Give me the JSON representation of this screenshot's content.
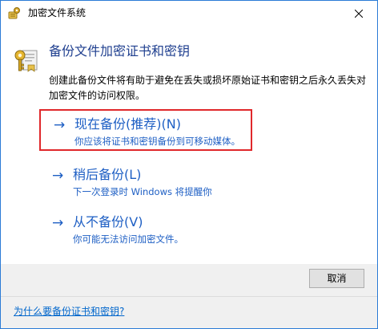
{
  "window": {
    "title": "加密文件系统",
    "close_label": "×"
  },
  "main": {
    "heading": "备份文件加密证书和密钥",
    "description": "创建此备份文件将有助于避免在丢失或损坏原始证书和密钥之后永久丢失对加密文件的访问权限。"
  },
  "options": [
    {
      "arrow": "→",
      "title": "现在备份(推荐)(N)",
      "subtitle": "你应该将证书和密钥备份到可移动媒体。"
    },
    {
      "arrow": "→",
      "title": "稍后备份(L)",
      "subtitle": "下一次登录时 Windows 将提醒你"
    },
    {
      "arrow": "→",
      "title": "从不备份(V)",
      "subtitle": "你可能无法访问加密文件。"
    }
  ],
  "footer": {
    "cancel_label": "取消",
    "help_link": "为什么要备份证书和密钥?"
  },
  "colors": {
    "link_blue": "#1e5fc4",
    "heading_blue": "#1f3f8f",
    "highlight_red": "#e0282b",
    "window_border": "#2b7bd6"
  }
}
